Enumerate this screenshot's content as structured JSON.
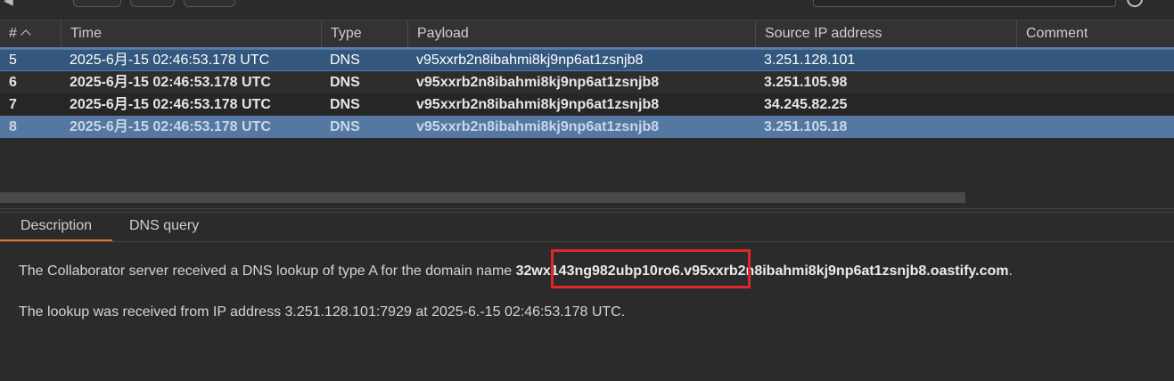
{
  "table": {
    "headers": {
      "num": "#",
      "time": "Time",
      "type": "Type",
      "payload": "Payload",
      "source_ip": "Source IP address",
      "comment": "Comment"
    },
    "rows": [
      {
        "num": "5",
        "time": "2025-6月-15 02:46:53.178 UTC",
        "type": "DNS",
        "payload": "v95xxrb2n8ibahmi8kj9np6at1zsnjb8",
        "source_ip": "3.251.128.101",
        "comment": ""
      },
      {
        "num": "6",
        "time": "2025-6月-15 02:46:53.178 UTC",
        "type": "DNS",
        "payload": "v95xxrb2n8ibahmi8kj9np6at1zsnjb8",
        "source_ip": "3.251.105.98",
        "comment": ""
      },
      {
        "num": "7",
        "time": "2025-6月-15 02:46:53.178 UTC",
        "type": "DNS",
        "payload": "v95xxrb2n8ibahmi8kj9np6at1zsnjb8",
        "source_ip": "34.245.82.25",
        "comment": ""
      },
      {
        "num": "8",
        "time": "2025-6月-15 02:46:53.178 UTC",
        "type": "DNS",
        "payload": "v95xxrb2n8ibahmi8kj9np6at1zsnjb8",
        "source_ip": "3.251.105.18",
        "comment": ""
      }
    ]
  },
  "tabs": {
    "description": "Description",
    "dns_query": "DNS query"
  },
  "description": {
    "line1_prefix": "The Collaborator server received a DNS lookup of type A for the domain name ",
    "domain": "32wx143ng982ubp10ro6.v95xxrb2n8ibahmi8kj9np6at1zsnjb8.oastify.com",
    "line1_suffix": ".",
    "line2": "The lookup was received from IP address 3.251.128.101:7929 at 2025-6.-15 02:46:53.178 UTC."
  },
  "colors": {
    "selected_row": "#34577d",
    "highlight_row": "#5578a3",
    "active_tab_underline": "#e0762e",
    "annotation_box": "#e0262a"
  },
  "icons": {
    "back": "arrow-left-icon",
    "sort": "chevron-up-icon",
    "help": "help-circle-icon"
  }
}
